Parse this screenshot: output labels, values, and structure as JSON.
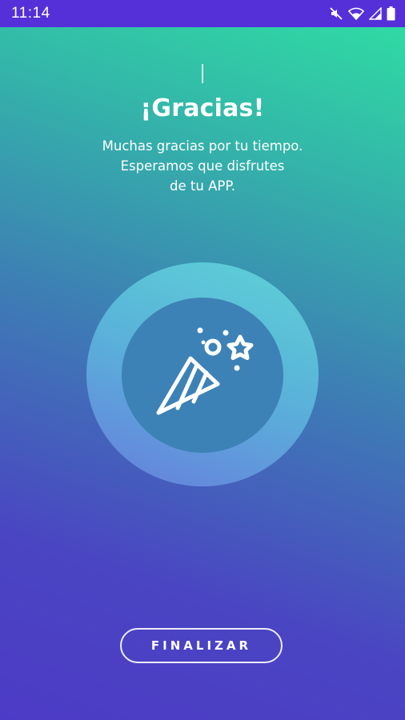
{
  "status_bar": {
    "time": "11:14",
    "icons": [
      "mute-icon",
      "wifi-icon",
      "signal-icon",
      "battery-icon"
    ],
    "background": "#5530d8"
  },
  "content": {
    "title": "¡Gracias!",
    "subtitle_lines": [
      "Muchas gracias por tu tiempo.",
      "Esperamos que disfrutes",
      "de tu APP."
    ],
    "illustration_icon": "party-popper-icon"
  },
  "actions": {
    "finalize_label": "FINALIZAR"
  },
  "colors": {
    "gradient_top": "#2fe0a3",
    "gradient_bottom": "#4c3bc6",
    "ring": "#5fd6d8",
    "ring_inner": "#3d82b6",
    "text": "#ffffff"
  }
}
